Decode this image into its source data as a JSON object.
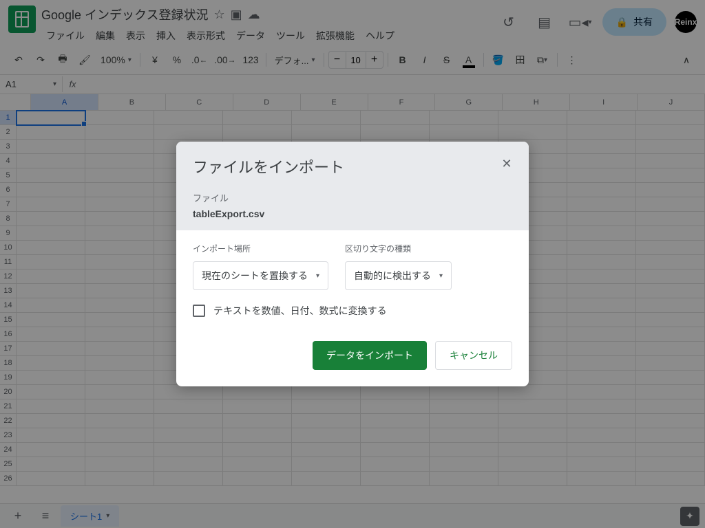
{
  "doc_title": "Google インデックス登録状況",
  "menus": [
    "ファイル",
    "編集",
    "表示",
    "挿入",
    "表示形式",
    "データ",
    "ツール",
    "拡張機能",
    "ヘルプ"
  ],
  "share_label": "共有",
  "avatar_text": "Reinx",
  "toolbar": {
    "zoom": "100%",
    "currency": "¥",
    "percent": "%",
    "dec_dec": ".0",
    "dec_inc": ".00",
    "123": "123",
    "font": "デフォ...",
    "font_size": "10"
  },
  "cell_ref": "A1",
  "columns": [
    "A",
    "B",
    "C",
    "D",
    "E",
    "F",
    "G",
    "H",
    "I",
    "J"
  ],
  "rows": [
    "1",
    "2",
    "3",
    "4",
    "5",
    "6",
    "7",
    "8",
    "9",
    "10",
    "11",
    "12",
    "13",
    "14",
    "15",
    "16",
    "17",
    "18",
    "19",
    "20",
    "21",
    "22",
    "23",
    "24",
    "25",
    "26"
  ],
  "sheet_tab": "シート1",
  "dialog": {
    "title": "ファイルをインポート",
    "file_label": "ファイル",
    "file_name": "tableExport.csv",
    "import_location_label": "インポート場所",
    "import_location_value": "現在のシートを置換する",
    "separator_label": "区切り文字の種類",
    "separator_value": "自動的に検出する",
    "checkbox_label": "テキストを数値、日付、数式に変換する",
    "import_button": "データをインポート",
    "cancel_button": "キャンセル"
  }
}
